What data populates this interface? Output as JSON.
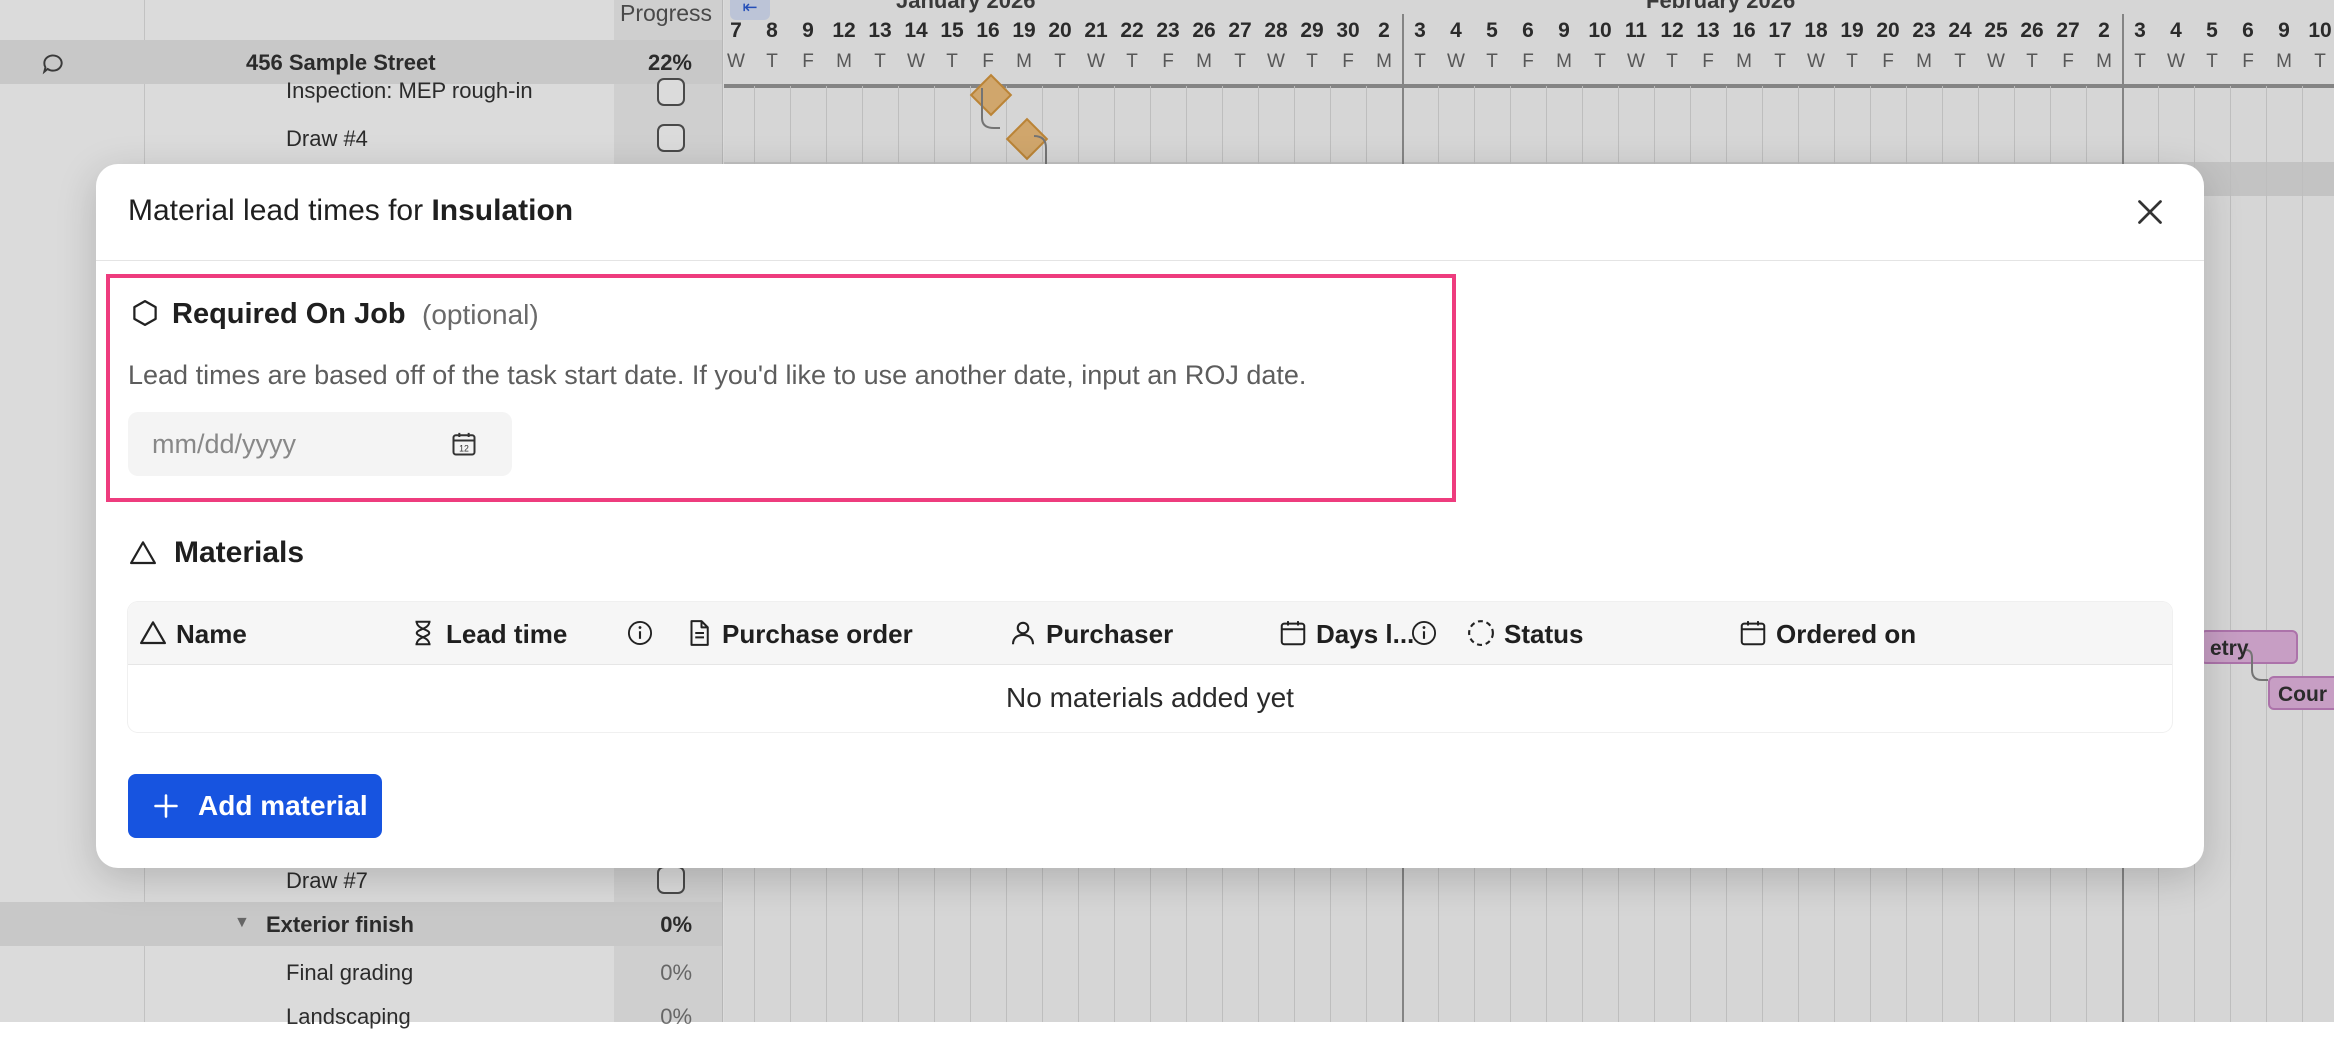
{
  "background": {
    "left_panel": {
      "progress_header": "Progress",
      "rows": [
        {
          "kind": "group",
          "name": "456 Sample Street",
          "progress": "22%",
          "has_chat_icon": true
        },
        {
          "kind": "task",
          "name": "Inspection: MEP rough-in",
          "checkbox": true
        },
        {
          "kind": "task",
          "name": "Draw #4",
          "checkbox": true
        },
        {
          "kind": "task",
          "name": "Draw #7",
          "checkbox": true
        },
        {
          "kind": "group",
          "name": "Exterior finish",
          "progress": "0%",
          "caret": "▼"
        },
        {
          "kind": "task",
          "name": "Final grading",
          "progress": "0%"
        },
        {
          "kind": "task",
          "name": "Landscaping",
          "progress": "0%"
        }
      ]
    },
    "timeline": {
      "months": [
        "January 2026",
        "February 2026"
      ],
      "days": [
        {
          "n": "7",
          "l": "W"
        },
        {
          "n": "8",
          "l": "T"
        },
        {
          "n": "9",
          "l": "F"
        },
        {
          "n": "12",
          "l": "M"
        },
        {
          "n": "13",
          "l": "T"
        },
        {
          "n": "14",
          "l": "W"
        },
        {
          "n": "15",
          "l": "T"
        },
        {
          "n": "16",
          "l": "F"
        },
        {
          "n": "19",
          "l": "M"
        },
        {
          "n": "20",
          "l": "T"
        },
        {
          "n": "21",
          "l": "W"
        },
        {
          "n": "22",
          "l": "T"
        },
        {
          "n": "23",
          "l": "F"
        },
        {
          "n": "26",
          "l": "M"
        },
        {
          "n": "27",
          "l": "T"
        },
        {
          "n": "28",
          "l": "W"
        },
        {
          "n": "29",
          "l": "T"
        },
        {
          "n": "30",
          "l": "F"
        },
        {
          "n": "2",
          "l": "M"
        },
        {
          "n": "3",
          "l": "T"
        },
        {
          "n": "4",
          "l": "W"
        },
        {
          "n": "5",
          "l": "T"
        },
        {
          "n": "6",
          "l": "F"
        },
        {
          "n": "9",
          "l": "M"
        },
        {
          "n": "10",
          "l": "T"
        },
        {
          "n": "11",
          "l": "W"
        },
        {
          "n": "12",
          "l": "T"
        },
        {
          "n": "13",
          "l": "F"
        },
        {
          "n": "16",
          "l": "M"
        },
        {
          "n": "17",
          "l": "T"
        },
        {
          "n": "18",
          "l": "W"
        },
        {
          "n": "19",
          "l": "T"
        },
        {
          "n": "20",
          "l": "F"
        },
        {
          "n": "23",
          "l": "M"
        },
        {
          "n": "24",
          "l": "T"
        },
        {
          "n": "25",
          "l": "W"
        },
        {
          "n": "26",
          "l": "T"
        },
        {
          "n": "27",
          "l": "F"
        },
        {
          "n": "2",
          "l": "M"
        },
        {
          "n": "3",
          "l": "T"
        },
        {
          "n": "4",
          "l": "W"
        },
        {
          "n": "5",
          "l": "T"
        },
        {
          "n": "6",
          "l": "F"
        },
        {
          "n": "9",
          "l": "M"
        },
        {
          "n": "10",
          "l": "T"
        }
      ],
      "pill_1": "etry",
      "pill_2": "Cour",
      "collapse_icon": "collapse-left-icon"
    }
  },
  "modal": {
    "title_prefix": "Material lead times for ",
    "title_subject": "Insulation",
    "close_icon": "close-icon",
    "roj": {
      "icon": "hexagon-icon",
      "heading": "Required On Job",
      "optional": "(optional)",
      "help_text": "Lead times are based off of the task start date. If you'd like to use another date, input an ROJ date.",
      "date_placeholder": "mm/dd/yyyy",
      "date_value": "",
      "calendar_icon": "calendar-icon",
      "highlight_color": "#ee3c7e"
    },
    "materials": {
      "icon": "triangle-icon",
      "heading": "Materials",
      "columns": [
        {
          "label": "Name",
          "icon": "triangle-icon"
        },
        {
          "label": "Lead time",
          "icon": "hourglass-icon",
          "info_icon": true
        },
        {
          "label": "Purchase order",
          "icon": "document-icon"
        },
        {
          "label": "Purchaser",
          "icon": "person-icon"
        },
        {
          "label": "Days l...",
          "icon": "calendar-icon",
          "info_icon": true
        },
        {
          "label": "Status",
          "icon": "dashed-circle-icon"
        },
        {
          "label": "Ordered on",
          "icon": "calendar-icon"
        }
      ],
      "rows": [],
      "empty_message": "No materials added yet"
    },
    "add_button": {
      "label": "Add material",
      "icon": "plus-icon",
      "color": "#1754e0"
    }
  }
}
